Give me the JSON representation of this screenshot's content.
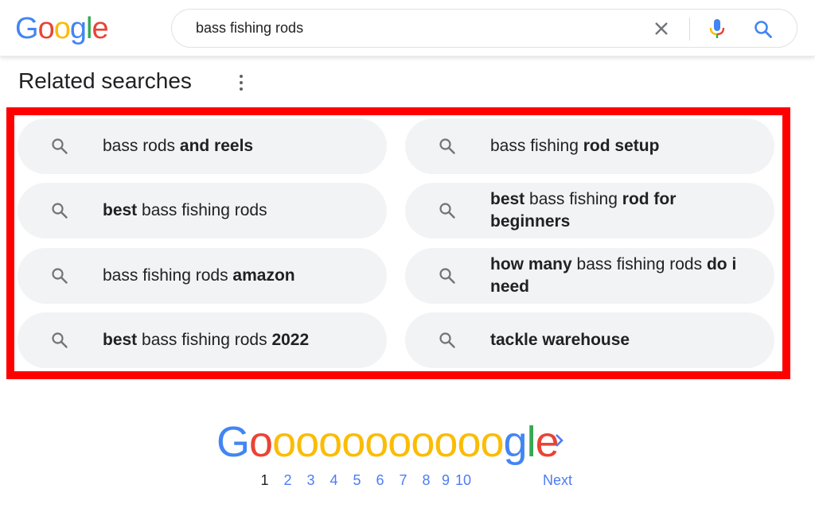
{
  "header": {
    "logo_letters": [
      {
        "ch": "G",
        "color": "#4285f4"
      },
      {
        "ch": "o",
        "color": "#ea4335"
      },
      {
        "ch": "o",
        "color": "#fbbc05"
      },
      {
        "ch": "g",
        "color": "#4285f4"
      },
      {
        "ch": "l",
        "color": "#34a853"
      },
      {
        "ch": "e",
        "color": "#ea4335"
      }
    ],
    "search": {
      "value": "bass fishing rods",
      "clear_icon": "close-icon",
      "mic_icon": "microphone-icon",
      "search_icon": "search-icon"
    }
  },
  "related": {
    "title": "Related searches",
    "more_icon": "more-vertical-icon",
    "highlight_color": "#ff0000",
    "items": [
      {
        "segments": [
          {
            "t": "bass rods ",
            "b": false
          },
          {
            "t": "and reels",
            "b": true
          }
        ]
      },
      {
        "segments": [
          {
            "t": "bass fishing ",
            "b": false
          },
          {
            "t": "rod setup",
            "b": true
          }
        ]
      },
      {
        "segments": [
          {
            "t": "best",
            "b": true
          },
          {
            "t": " bass fishing rods",
            "b": false
          }
        ]
      },
      {
        "segments": [
          {
            "t": "best",
            "b": true
          },
          {
            "t": " bass fishing ",
            "b": false
          },
          {
            "t": "rod for beginners",
            "b": true
          }
        ]
      },
      {
        "segments": [
          {
            "t": "bass fishing rods ",
            "b": false
          },
          {
            "t": "amazon",
            "b": true
          }
        ]
      },
      {
        "segments": [
          {
            "t": "how many",
            "b": true
          },
          {
            "t": " bass fishing rods ",
            "b": false
          },
          {
            "t": "do i need",
            "b": true
          }
        ]
      },
      {
        "segments": [
          {
            "t": "best",
            "b": true
          },
          {
            "t": " bass fishing rods ",
            "b": false
          },
          {
            "t": "2022",
            "b": true
          }
        ]
      },
      {
        "segments": [
          {
            "t": "tackle warehouse",
            "b": true
          }
        ]
      }
    ]
  },
  "pagination": {
    "logo_letters": [
      {
        "ch": "G",
        "color": "#4285f4"
      },
      {
        "ch": "o",
        "color": "#ea4335"
      },
      {
        "ch": "o",
        "color": "#fbbc05"
      },
      {
        "ch": "o",
        "color": "#fbbc05"
      },
      {
        "ch": "o",
        "color": "#fbbc05"
      },
      {
        "ch": "o",
        "color": "#fbbc05"
      },
      {
        "ch": "o",
        "color": "#fbbc05"
      },
      {
        "ch": "o",
        "color": "#fbbc05"
      },
      {
        "ch": "o",
        "color": "#fbbc05"
      },
      {
        "ch": "o",
        "color": "#fbbc05"
      },
      {
        "ch": "o",
        "color": "#fbbc05"
      },
      {
        "ch": "o",
        "color": "#fbbc05"
      },
      {
        "ch": "g",
        "color": "#4285f4"
      },
      {
        "ch": "l",
        "color": "#34a853"
      },
      {
        "ch": "e",
        "color": "#ea4335"
      }
    ],
    "pages": [
      "1",
      "2",
      "3",
      "4",
      "5",
      "6",
      "7",
      "8",
      "9",
      "10"
    ],
    "current_page": "1",
    "next_label": "Next",
    "next_icon": "chevron-right-icon",
    "link_color": "#4d7cf5"
  }
}
